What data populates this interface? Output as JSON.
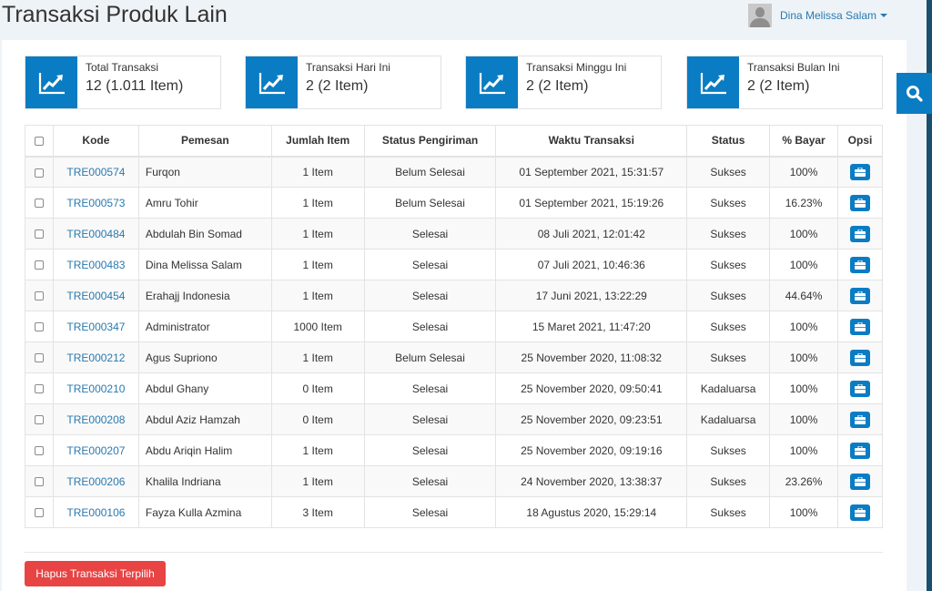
{
  "header": {
    "title": "Transaksi Produk Lain",
    "user": {
      "name": "Dina Melissa Salam",
      "avatar_icon": "user-silhouette-icon",
      "dropdown_icon": "caret-down-icon"
    }
  },
  "search_button": {
    "icon": "search-icon"
  },
  "stats": [
    {
      "label": "Total Transaksi",
      "value": "12 (1.011 Item)",
      "icon": "trend-chart-icon"
    },
    {
      "label": "Transaksi Hari Ini",
      "value": "2 (2 Item)",
      "icon": "trend-chart-icon"
    },
    {
      "label": "Transaksi Minggu Ini",
      "value": "2 (2 Item)",
      "icon": "trend-chart-icon"
    },
    {
      "label": "Transaksi Bulan Ini",
      "value": "2 (2 Item)",
      "icon": "trend-chart-icon"
    }
  ],
  "table": {
    "columns": [
      "Kode",
      "Pemesan",
      "Jumlah Item",
      "Status Pengiriman",
      "Waktu Transaksi",
      "Status",
      "% Bayar",
      "Opsi"
    ],
    "rows": [
      {
        "kode": "TRE000574",
        "pemesan": "Furqon",
        "jumlah": "1 Item",
        "pengiriman": "Belum Selesai",
        "waktu": "01 September 2021, 15:31:57",
        "status": "Sukses",
        "bayar": "100%"
      },
      {
        "kode": "TRE000573",
        "pemesan": "Amru Tohir",
        "jumlah": "1 Item",
        "pengiriman": "Belum Selesai",
        "waktu": "01 September 2021, 15:19:26",
        "status": "Sukses",
        "bayar": "16.23%"
      },
      {
        "kode": "TRE000484",
        "pemesan": "Abdulah Bin Somad",
        "jumlah": "1 Item",
        "pengiriman": "Selesai",
        "waktu": "08 Juli 2021, 12:01:42",
        "status": "Sukses",
        "bayar": "100%"
      },
      {
        "kode": "TRE000483",
        "pemesan": "Dina Melissa Salam",
        "jumlah": "1 Item",
        "pengiriman": "Selesai",
        "waktu": "07 Juli 2021, 10:46:36",
        "status": "Sukses",
        "bayar": "100%"
      },
      {
        "kode": "TRE000454",
        "pemesan": "Erahajj Indonesia",
        "jumlah": "1 Item",
        "pengiriman": "Selesai",
        "waktu": "17 Juni 2021, 13:22:29",
        "status": "Sukses",
        "bayar": "44.64%"
      },
      {
        "kode": "TRE000347",
        "pemesan": "Administrator",
        "jumlah": "1000 Item",
        "pengiriman": "Selesai",
        "waktu": "15 Maret 2021, 11:47:20",
        "status": "Sukses",
        "bayar": "100%"
      },
      {
        "kode": "TRE000212",
        "pemesan": "Agus Supriono",
        "jumlah": "1 Item",
        "pengiriman": "Belum Selesai",
        "waktu": "25 November 2020, 11:08:32",
        "status": "Sukses",
        "bayar": "100%"
      },
      {
        "kode": "TRE000210",
        "pemesan": "Abdul Ghany",
        "jumlah": "0 Item",
        "pengiriman": "Selesai",
        "waktu": "25 November 2020, 09:50:41",
        "status": "Kadaluarsa",
        "bayar": "100%"
      },
      {
        "kode": "TRE000208",
        "pemesan": "Abdul Aziz Hamzah",
        "jumlah": "0 Item",
        "pengiriman": "Selesai",
        "waktu": "25 November 2020, 09:23:51",
        "status": "Kadaluarsa",
        "bayar": "100%"
      },
      {
        "kode": "TRE000207",
        "pemesan": "Abdu Ariqin Halim",
        "jumlah": "1 Item",
        "pengiriman": "Selesai",
        "waktu": "25 November 2020, 09:19:16",
        "status": "Sukses",
        "bayar": "100%"
      },
      {
        "kode": "TRE000206",
        "pemesan": "Khalila Indriana",
        "jumlah": "1 Item",
        "pengiriman": "Selesai",
        "waktu": "24 November 2020, 13:38:37",
        "status": "Sukses",
        "bayar": "23.26%"
      },
      {
        "kode": "TRE000106",
        "pemesan": "Fayza Kulla Azmina",
        "jumlah": "3 Item",
        "pengiriman": "Selesai",
        "waktu": "18 Agustus 2020, 15:29:14",
        "status": "Sukses",
        "bayar": "100%"
      }
    ],
    "row_action_icon": "briefcase-icon"
  },
  "actions": {
    "delete_selected_label": "Hapus Transaksi Terpilih"
  },
  "colors": {
    "primary": "#0a7cc3",
    "link": "#2a7ab0",
    "danger": "#e84444",
    "background": "#eef3f8"
  }
}
